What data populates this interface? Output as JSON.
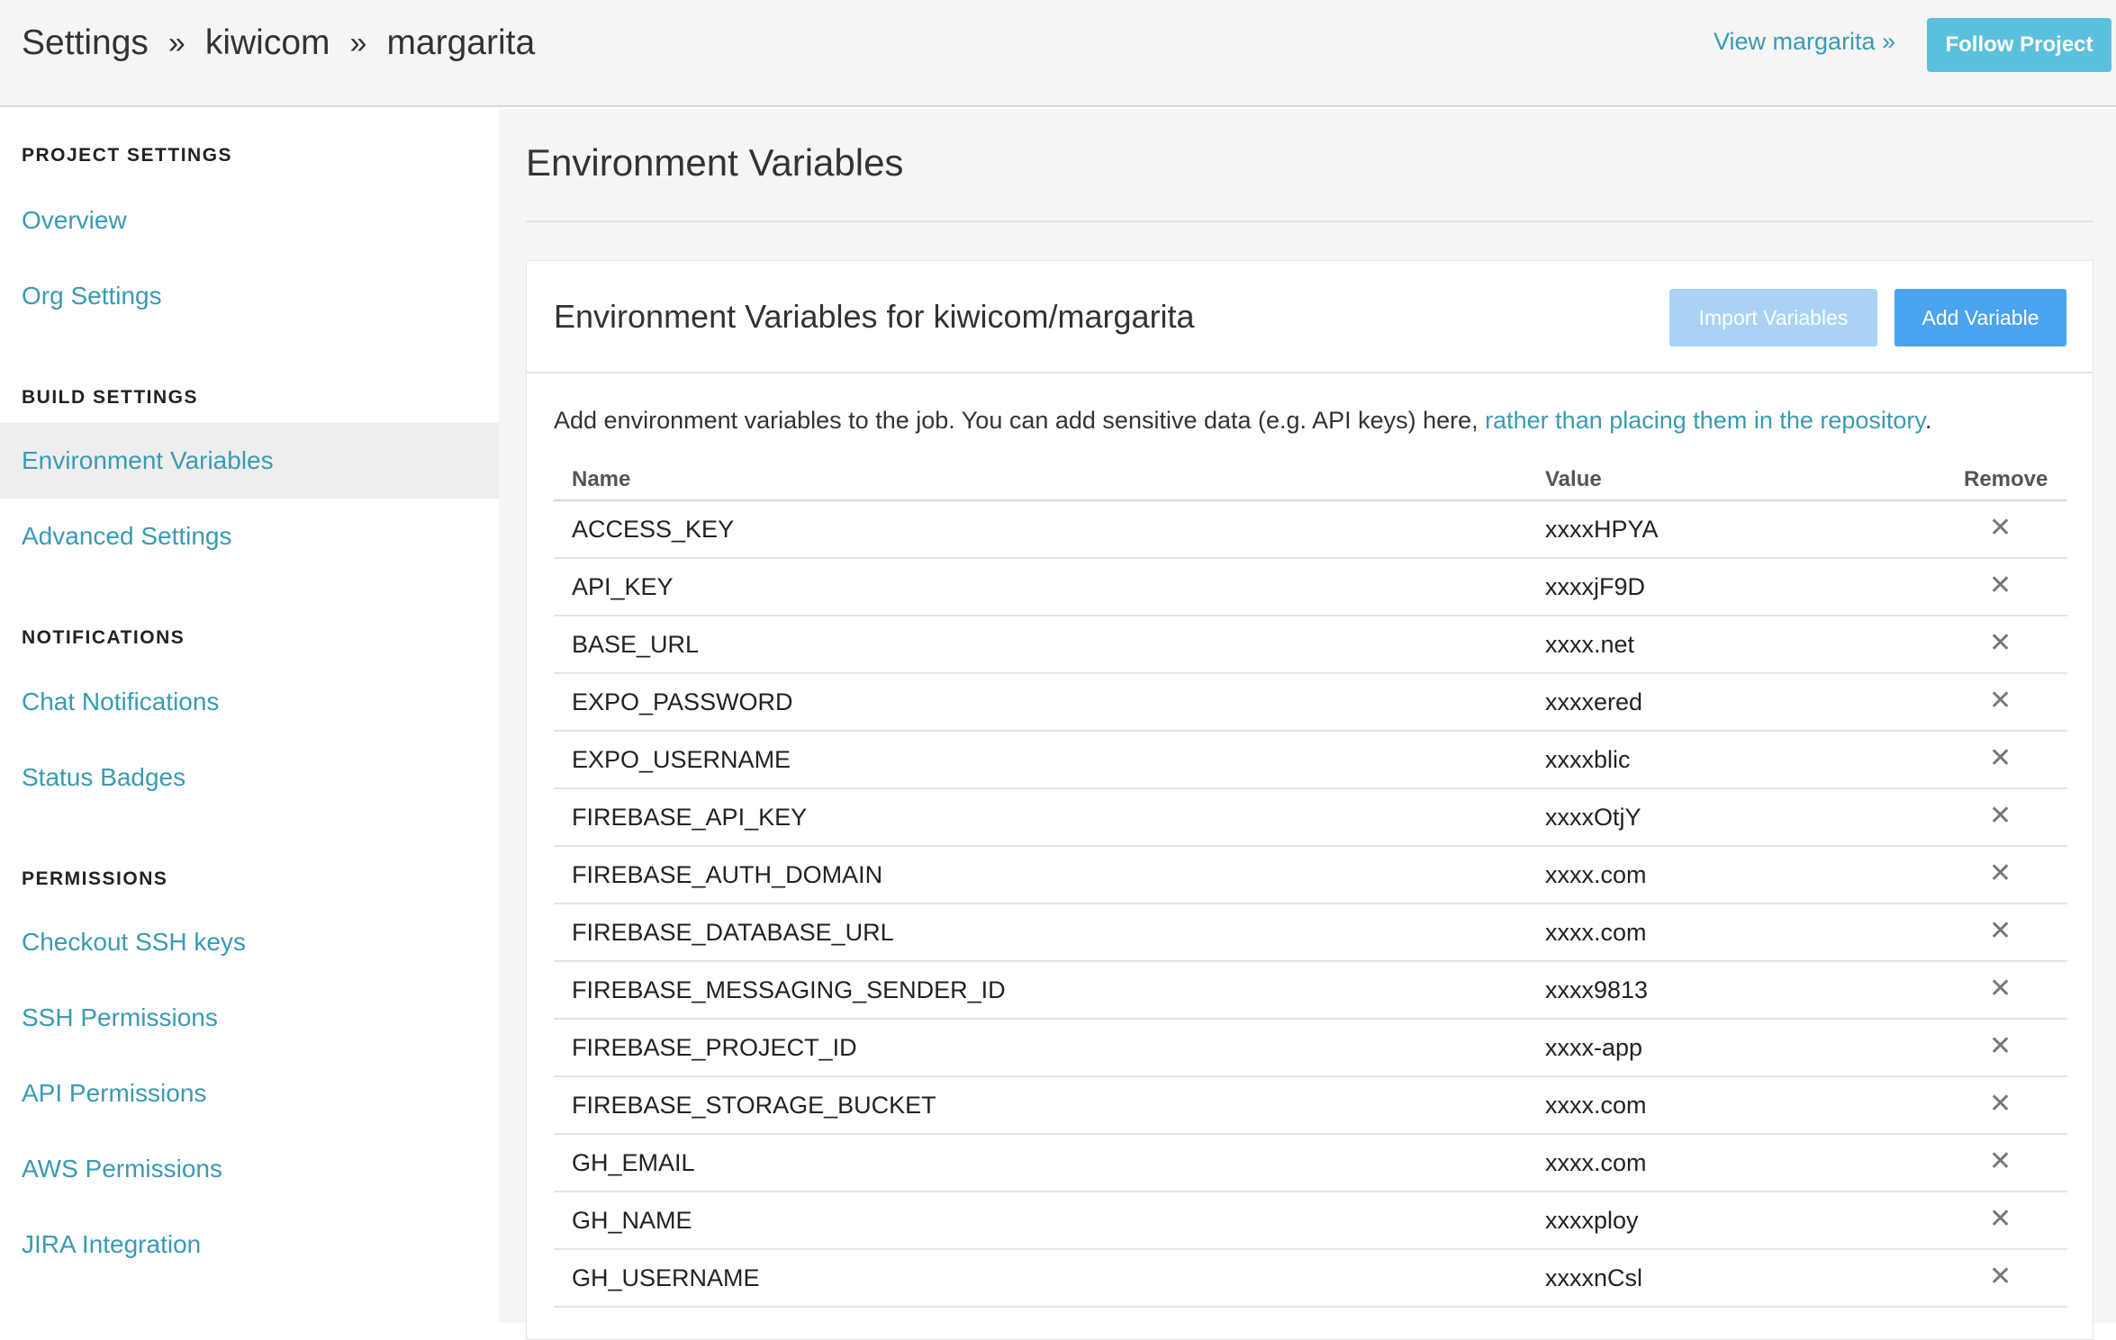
{
  "header": {
    "breadcrumb": [
      "Settings",
      "kiwicom",
      "margarita"
    ],
    "separator": "»",
    "view_link": "View margarita »",
    "follow_button": "Follow Project"
  },
  "sidebar": {
    "sections": [
      {
        "title": "PROJECT SETTINGS",
        "items": [
          "Overview",
          "Org Settings"
        ]
      },
      {
        "title": "BUILD SETTINGS",
        "items": [
          "Environment Variables",
          "Advanced Settings"
        ]
      },
      {
        "title": "NOTIFICATIONS",
        "items": [
          "Chat Notifications",
          "Status Badges"
        ]
      },
      {
        "title": "PERMISSIONS",
        "items": [
          "Checkout SSH keys",
          "SSH Permissions",
          "API Permissions",
          "AWS Permissions",
          "JIRA Integration"
        ]
      }
    ],
    "active_item": "Environment Variables"
  },
  "main": {
    "page_title": "Environment Variables",
    "card_title": "Environment Variables for kiwicom/margarita",
    "import_button": "Import Variables",
    "add_button": "Add Variable",
    "description": "Add environment variables to the job. You can add sensitive data (e.g. API keys) here, ",
    "description_link": "rather than placing them in the repository",
    "description_end": ".",
    "columns": [
      "Name",
      "Value",
      "Remove"
    ],
    "remove_glyph": "✕",
    "rows": [
      {
        "name": "ACCESS_KEY",
        "value": "xxxxHPYA"
      },
      {
        "name": "API_KEY",
        "value": "xxxxjF9D"
      },
      {
        "name": "BASE_URL",
        "value": "xxxx.net"
      },
      {
        "name": "EXPO_PASSWORD",
        "value": "xxxxered"
      },
      {
        "name": "EXPO_USERNAME",
        "value": "xxxxblic"
      },
      {
        "name": "FIREBASE_API_KEY",
        "value": "xxxxOtjY"
      },
      {
        "name": "FIREBASE_AUTH_DOMAIN",
        "value": "xxxx.com"
      },
      {
        "name": "FIREBASE_DATABASE_URL",
        "value": "xxxx.com"
      },
      {
        "name": "FIREBASE_MESSAGING_SENDER_ID",
        "value": "xxxx9813"
      },
      {
        "name": "FIREBASE_PROJECT_ID",
        "value": "xxxx-app"
      },
      {
        "name": "FIREBASE_STORAGE_BUCKET",
        "value": "xxxx.com"
      },
      {
        "name": "GH_EMAIL",
        "value": "xxxx.com"
      },
      {
        "name": "GH_NAME",
        "value": "xxxxploy"
      },
      {
        "name": "GH_USERNAME",
        "value": "xxxxnCsl"
      }
    ]
  },
  "colors": {
    "link": "#3a9ab3",
    "follow_button": "#5bc0de",
    "add_button": "#4aa3ee",
    "import_button": "#a9d2f5"
  }
}
